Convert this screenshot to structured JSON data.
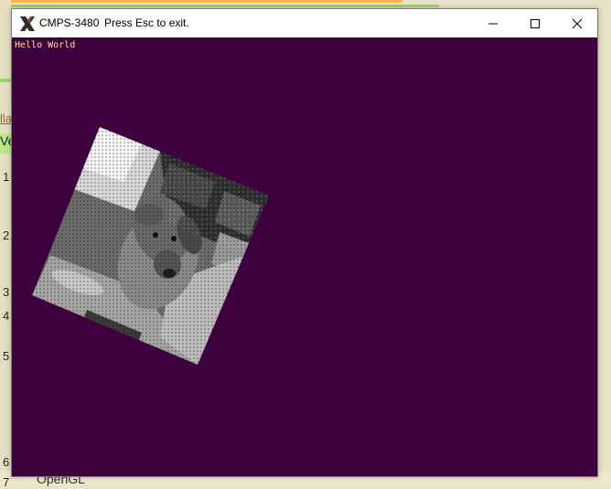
{
  "window": {
    "app_name": "CMPS-3480",
    "hint": "Press Esc to exit.",
    "minimize_label": "",
    "maximize_label": "",
    "close_label": ""
  },
  "client": {
    "background_color": "#3f003e",
    "text_overlay": "Hello World",
    "text_color": "#ffe08a",
    "image_subject": "dog photo, grayscale dithered, rotated"
  },
  "background_app": {
    "row_numbers": [
      "1",
      "2",
      "3",
      "4",
      "5",
      "6",
      "7"
    ],
    "bottom_text": "OpenGL",
    "side_fragments": [
      "lla",
      "Ve"
    ]
  }
}
